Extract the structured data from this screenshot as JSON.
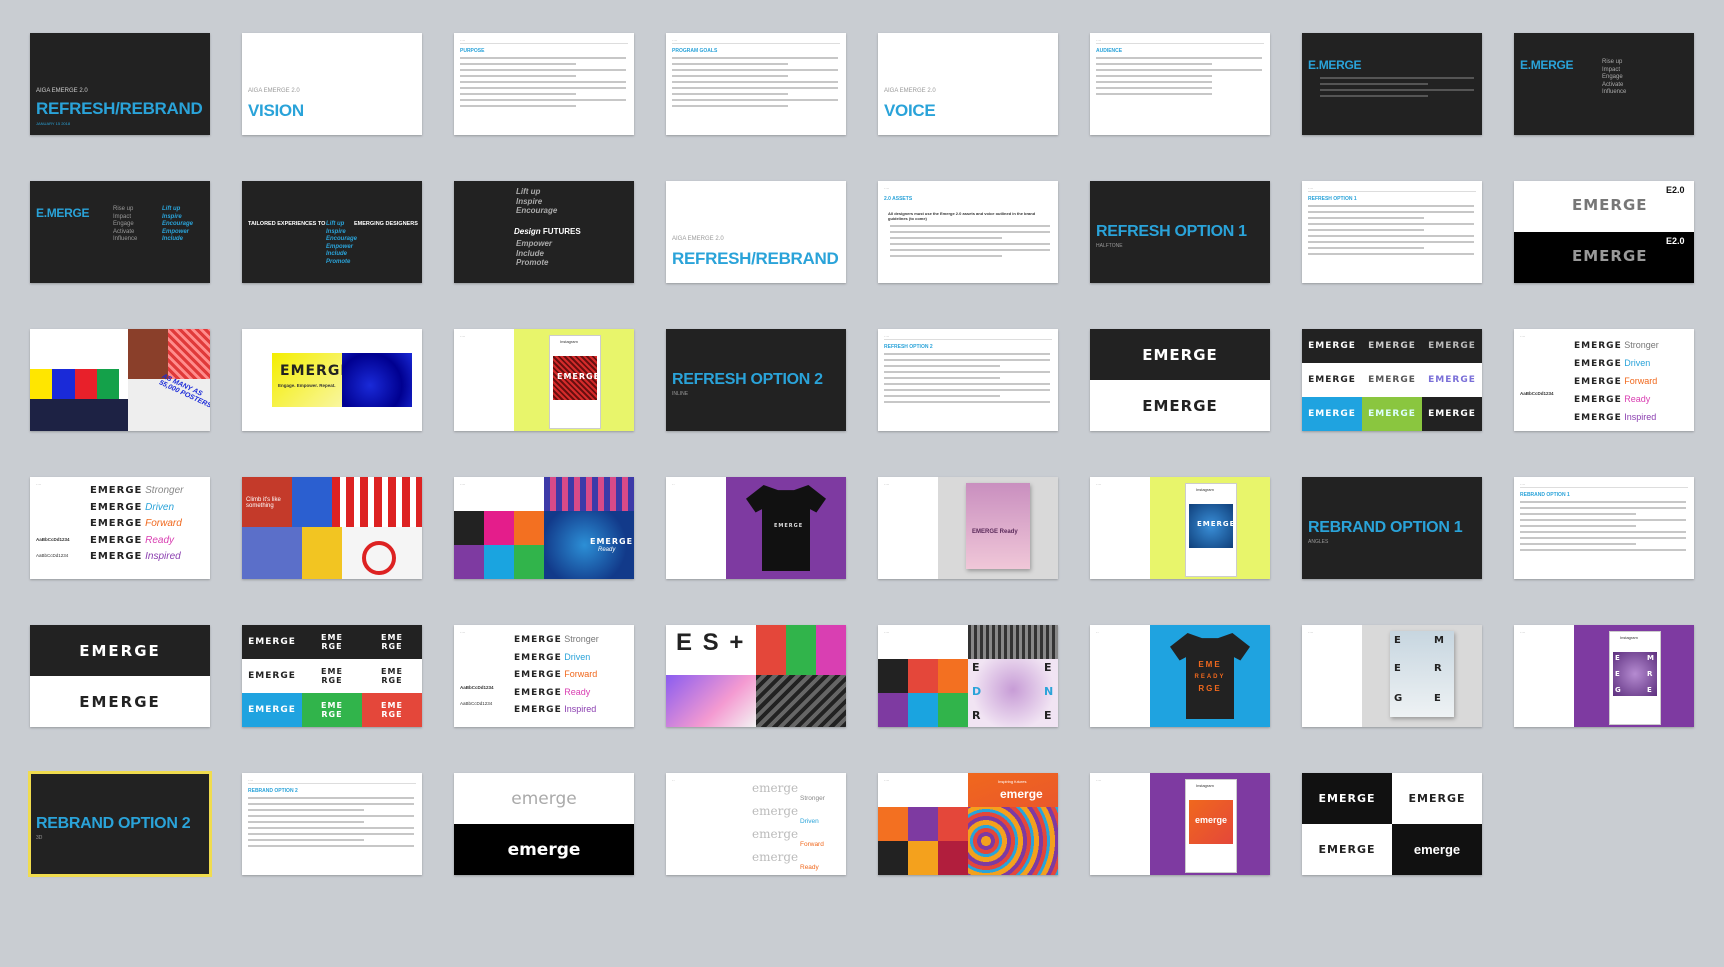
{
  "slides": {
    "s1": {
      "kicker": "AIGA EMERGE 2.0",
      "title": "REFRESH/REBRAND",
      "sub": "JANUARY 15 2018"
    },
    "s2": {
      "kicker": "AIGA EMERGE 2.0",
      "title": "VISION"
    },
    "s3": {
      "heading": "PURPOSE"
    },
    "s4": {
      "heading": "PROGRAM GOALS"
    },
    "s5": {
      "kicker": "AIGA EMERGE 2.0",
      "title": "VOICE"
    },
    "s6": {
      "heading": "AUDIENCE"
    },
    "s7": {
      "title": "E.MERGE"
    },
    "s8": {
      "title": "E.MERGE",
      "words": [
        "Rise up",
        "Impact",
        "Engage",
        "Activate",
        "Influence"
      ]
    },
    "s9": {
      "title": "E.MERGE",
      "words_gray": [
        "Rise up",
        "Impact",
        "Engage",
        "Activate",
        "Influence"
      ],
      "words_blue": [
        "Lift up",
        "Inspire",
        "Encourage",
        "Empower",
        "Include"
      ]
    },
    "s10": {
      "left": "TAILORED EXPERIENCES TO",
      "right": "EMERGING DESIGNERS",
      "words": [
        "Lift up",
        "Inspire",
        "Encourage",
        "Empower",
        "Include",
        "Promote"
      ]
    },
    "s11": {
      "words": [
        "Lift up",
        "Inspire",
        "Encourage"
      ],
      "focus": "Design",
      "focus2": "FUTURES",
      "words2": [
        "Empower",
        "Include",
        "Promote"
      ]
    },
    "s12": {
      "kicker": "AIGA EMERGE 2.0",
      "title": "REFRESH/REBRAND"
    },
    "s13": {
      "heading": "2.0 ASSETS",
      "bullet": "All designers must use the Emerge 2.0 assets and voice outlined in the brand guidelines (to come)"
    },
    "s14": {
      "title": "REFRESH OPTION 1",
      "sub": "HALFTONE"
    },
    "s15": {
      "heading": "REFRESH OPTION 1"
    },
    "s16": {
      "word": "EMERGE",
      "tag": "E2.0"
    },
    "s17": {
      "poster_text": "AS MANY AS 55,000 POSTERS"
    },
    "s18": {
      "word": "EMERGE",
      "tagline": "Engage. Empower. Repeat."
    },
    "s19": {
      "app": "Instagram",
      "word": "EMERGE"
    },
    "s20": {
      "title": "REFRESH OPTION 2",
      "sub": "INLINE"
    },
    "s21": {
      "heading": "REFRESH OPTION 2"
    },
    "s22": {
      "word": "EMERGE"
    },
    "s23": {
      "word": "EMERGE"
    },
    "s24": {
      "word": "EMERGE",
      "words": [
        "Stronger",
        "Driven",
        "Forward",
        "Ready",
        "Inspired"
      ],
      "spec": "AaBbCcDd1234"
    },
    "s25": {
      "word": "EMERGE",
      "words": [
        "Stronger",
        "Driven",
        "Forward",
        "Ready",
        "Inspired"
      ],
      "spec": "AaBbCcDd1234",
      "spec2": "AaBbCcDd1234"
    },
    "s26": {
      "text": "Climb it's like something"
    },
    "s27": {
      "word": "EMERGE",
      "tag": "Ready"
    },
    "s28": {
      "word": "EMERGE"
    },
    "s29": {
      "word": "EMERGE Ready"
    },
    "s30": {
      "app": "Instagram",
      "word": "EMERGE"
    },
    "s31": {
      "title": "REBRAND OPTION 1",
      "sub": "ANGLES"
    },
    "s32": {
      "heading": "REBRAND OPTION 1"
    },
    "s33": {
      "word": "EMERGE"
    },
    "s34": {
      "word": "EMERGE",
      "split": [
        "EME",
        "RGE"
      ]
    },
    "s35": {
      "word": "EMERGE",
      "words": [
        "Stronger",
        "Driven",
        "Forward",
        "Ready",
        "Inspired"
      ],
      "spec": "AaBbCcDd1234",
      "spec2": "AaBbCcDd1234"
    },
    "s36": {
      "text": "E S +"
    },
    "s37": {
      "letters": [
        "E",
        "E",
        "D",
        "N",
        "R",
        "E"
      ]
    },
    "s38": {
      "lines": [
        "EME",
        "READY",
        "RGE"
      ]
    },
    "s39": {
      "letters": [
        "E",
        "M",
        "E",
        "R",
        "G",
        "E"
      ]
    },
    "s40": {
      "app": "Instagram",
      "letters": [
        "E",
        "M",
        "E",
        "R",
        "G",
        "E"
      ]
    },
    "s41": {
      "title": "REBRAND OPTION 2",
      "sub": "3D"
    },
    "s42": {
      "heading": "REBRAND OPTION 2"
    },
    "s43": {
      "word": "emerge"
    },
    "s44": {
      "word": "emerge",
      "words": [
        "Stronger",
        "Driven",
        "Forward",
        "Ready"
      ]
    },
    "s45": {
      "word": "emerge",
      "kicker": "Inspiring futures"
    },
    "s46": {
      "app": "Instagram",
      "word": "emerge"
    },
    "s47": {
      "word": "EMERGE",
      "word2": "emerge"
    }
  },
  "colors": {
    "accent": "#2aa3d9",
    "dark": "#222222",
    "lime": "#e8f56b",
    "purple": "#7e3aa1",
    "orange": "#f0681d"
  }
}
